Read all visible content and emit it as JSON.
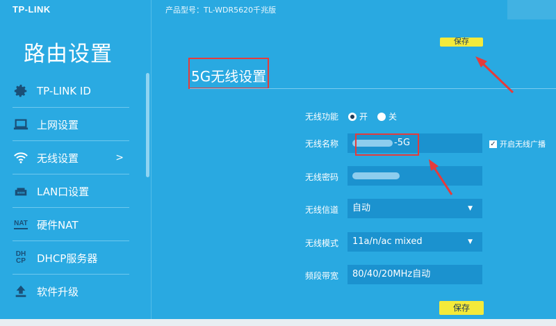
{
  "brand": "TP-LINK",
  "sidebar": {
    "title": "路由设置",
    "items": [
      {
        "label": "TP-LINK ID",
        "icon": "gear-icon"
      },
      {
        "label": "上网设置",
        "icon": "laptop-icon"
      },
      {
        "label": "无线设置",
        "icon": "wifi-icon",
        "arrow": ">"
      },
      {
        "label": "LAN口设置",
        "icon": "lan-icon"
      },
      {
        "label": "硬件NAT",
        "icon": "nat-icon",
        "icon_text": "NAT"
      },
      {
        "label": "DHCP服务器",
        "icon": "dhcp-icon",
        "icon_text_1": "DH",
        "icon_text_2": "CP"
      },
      {
        "label": "软件升级",
        "icon": "upload-icon"
      }
    ]
  },
  "header": {
    "model": "产品型号：TL-WDR5620千兆版"
  },
  "toolbar": {
    "save_top": "保存",
    "save_bottom": "保存"
  },
  "section": {
    "title": "5G无线设置"
  },
  "form": {
    "wireless_func": {
      "label": "无线功能",
      "on": "开",
      "off": "关",
      "selected": "on"
    },
    "ssid": {
      "label": "无线名称",
      "value_suffix": "-5G"
    },
    "broadcast": {
      "label": "开启无线广播",
      "checked": true
    },
    "password": {
      "label": "无线密码"
    },
    "channel": {
      "label": "无线信道",
      "value": "自动"
    },
    "mode": {
      "label": "无线模式",
      "value": "11a/n/ac mixed"
    },
    "bandwidth": {
      "label": "频段带宽",
      "value": "80/40/20MHz自动"
    }
  },
  "colors": {
    "background": "#29a9e1",
    "field": "#1b92cf",
    "button": "#f4ea3a",
    "annotation": "#e53b3b"
  }
}
